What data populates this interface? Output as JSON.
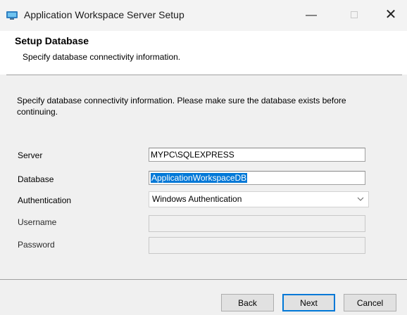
{
  "window": {
    "title": "Application Workspace Server Setup",
    "minimize_glyph": "—",
    "close_glyph": "✕"
  },
  "banner": {
    "title": "Setup Database",
    "subtitle": "Specify database connectivity information."
  },
  "intro": "Specify database connectivity information. Please make sure the database exists before continuing.",
  "form": {
    "server_label": "Server",
    "server_value": "MYPC\\SQLEXPRESS",
    "database_label": "Database",
    "database_value": "ApplicationWorkspaceDB",
    "authentication_label": "Authentication",
    "authentication_value": "Windows Authentication",
    "username_label": "Username",
    "username_value": "",
    "password_label": "Password",
    "password_value": ""
  },
  "buttons": {
    "back": "Back",
    "next": "Next",
    "cancel": "Cancel"
  },
  "icons": {
    "app": "setup-app-icon",
    "chevron": "chevron-down-icon"
  },
  "colors": {
    "accent": "#0078d7",
    "window_bg": "#f0f0f0",
    "banner_bg": "#ffffff"
  }
}
